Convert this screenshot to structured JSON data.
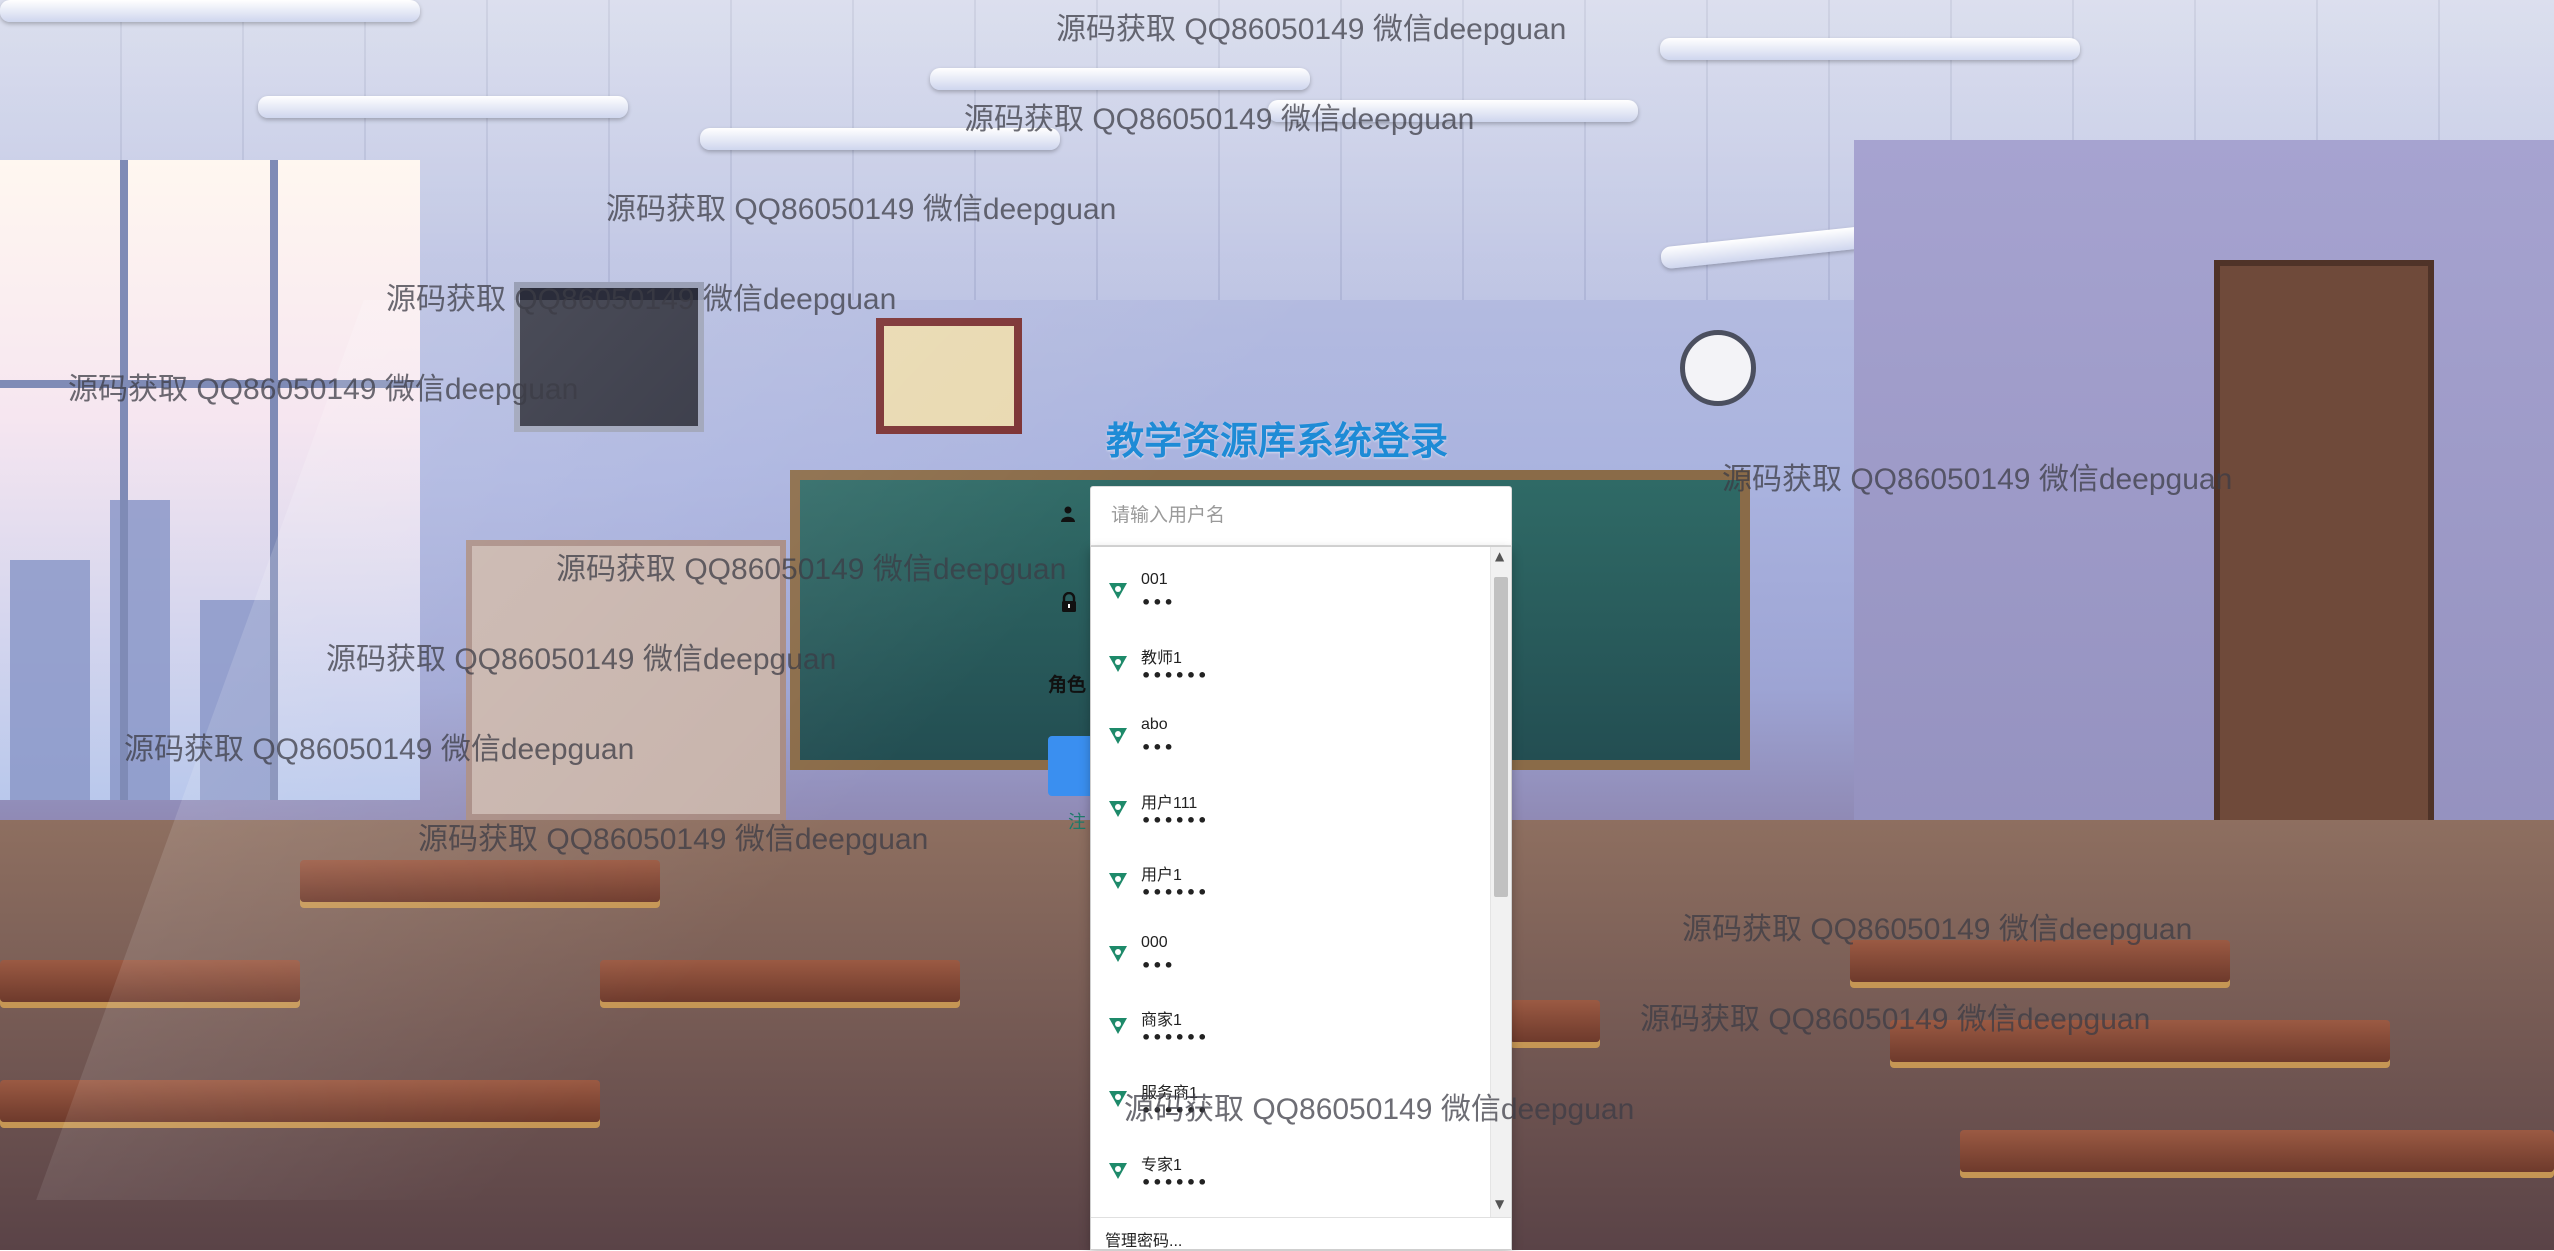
{
  "login": {
    "title": "教学资源库系统登录",
    "username_placeholder": "请输入用户名",
    "role_label": "角色",
    "register_edge": "注"
  },
  "autofill": {
    "entries": [
      {
        "user": "001",
        "mask": "•••"
      },
      {
        "user": "教师1",
        "mask": "••••••"
      },
      {
        "user": "abo",
        "mask": "•••"
      },
      {
        "user": "用户111",
        "mask": "••••••"
      },
      {
        "user": "用户1",
        "mask": "••••••"
      },
      {
        "user": "000",
        "mask": "•••"
      },
      {
        "user": "商家1",
        "mask": "••••••"
      },
      {
        "user": "服务商1",
        "mask": "••••••"
      },
      {
        "user": "专家1",
        "mask": "••••••"
      }
    ],
    "manage_label": "管理密码..."
  },
  "watermark": {
    "text": "源码获取 QQ86050149 微信deepguan"
  },
  "icons": {
    "user": "user-icon",
    "lock": "lock-icon",
    "key": "key-icon"
  }
}
